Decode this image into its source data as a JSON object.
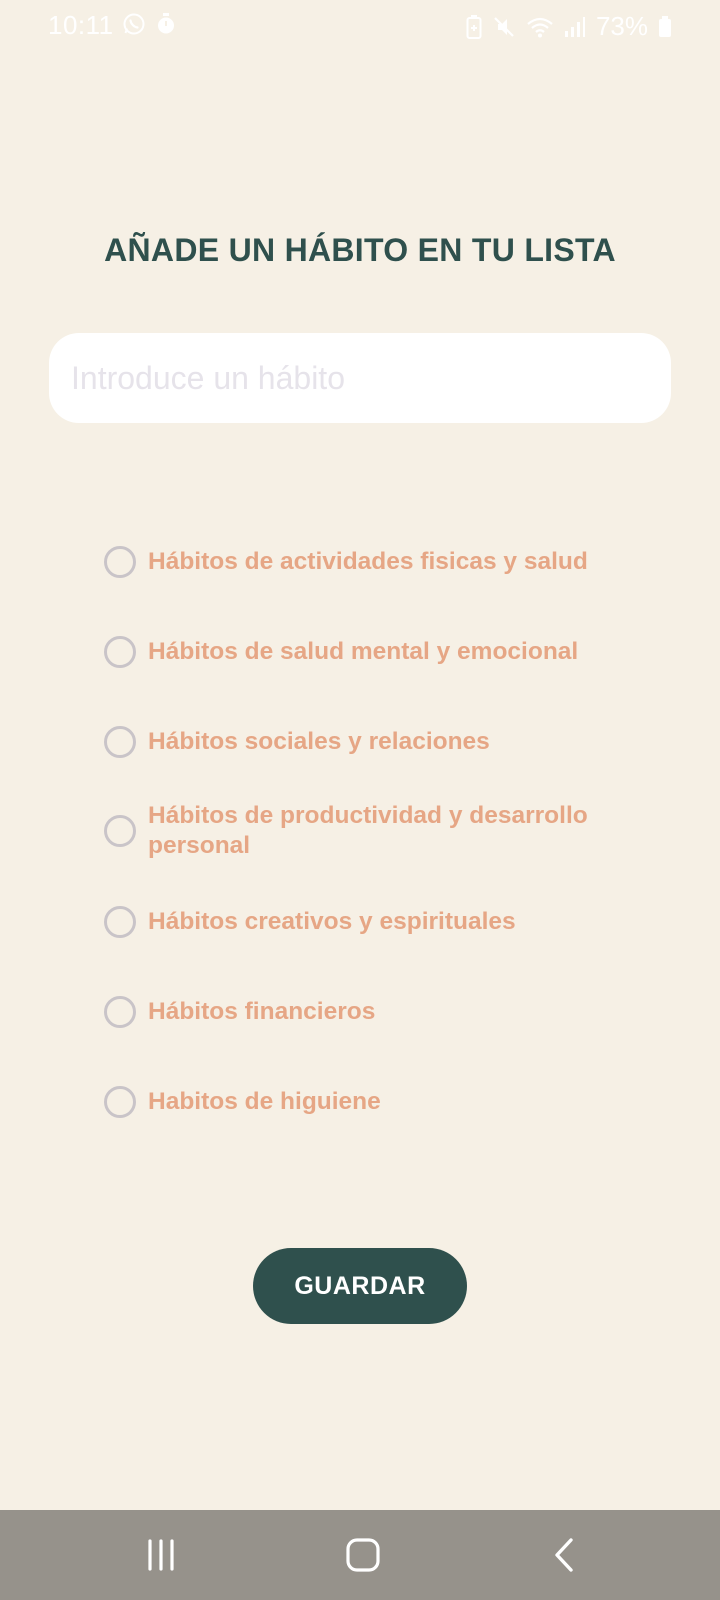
{
  "status_bar": {
    "time": "10:11",
    "left_icons": [
      "whatsapp-icon",
      "timer-icon"
    ],
    "right_icons": [
      "battery-saver-icon",
      "mute-icon",
      "wifi-icon",
      "signal-icon"
    ],
    "battery": "73%"
  },
  "page": {
    "title": "AÑADE UN HÁBITO EN TU LISTA"
  },
  "habit_input": {
    "value": "",
    "placeholder": "Introduce un hábito"
  },
  "categories": [
    {
      "label": "Hábitos de actividades fisicas y salud",
      "selected": false
    },
    {
      "label": "Hábitos de salud mental y emocional",
      "selected": false
    },
    {
      "label": "Hábitos sociales y relaciones",
      "selected": false
    },
    {
      "label": "Hábitos de productividad y desarrollo personal",
      "selected": false
    },
    {
      "label": "Hábitos creativos y espirituales",
      "selected": false
    },
    {
      "label": "Hábitos financieros",
      "selected": false
    },
    {
      "label": "Habitos de higuiene",
      "selected": false
    }
  ],
  "save_button": {
    "label": "GUARDAR"
  },
  "nav_bar": {
    "buttons": [
      "recent-apps-icon",
      "home-icon",
      "back-icon"
    ]
  },
  "colors": {
    "background": "#F6F0E5",
    "primary": "#2F504D",
    "accent": "#E6A685",
    "radio_border": "#C9C4C8",
    "nav_bar": "#96928B"
  }
}
